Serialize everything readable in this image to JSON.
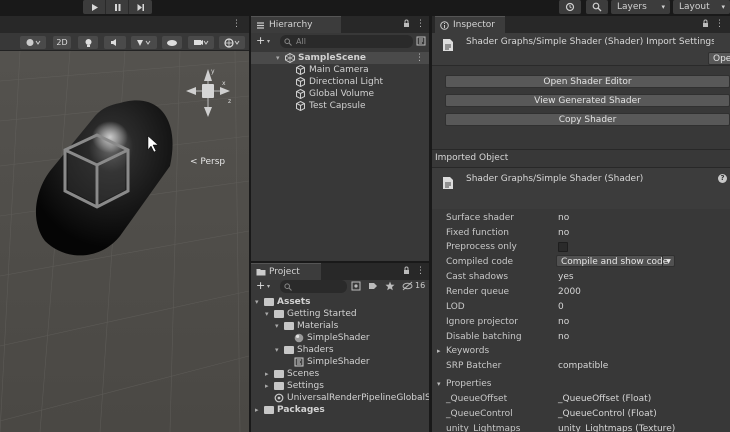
{
  "toolbar": {
    "layers_label": "Layers",
    "layout_label": "Layout",
    "caret": "▾"
  },
  "scene": {
    "mode_2d": "2D",
    "persp_label": "< Persp"
  },
  "hierarchy": {
    "tab_label": "Hierarchy",
    "add_label": "+",
    "search_placeholder": "All",
    "items": [
      {
        "label": "SampleScene"
      },
      {
        "label": "Main Camera"
      },
      {
        "label": "Directional Light"
      },
      {
        "label": "Global Volume"
      },
      {
        "label": "Test Capsule"
      }
    ]
  },
  "project": {
    "tab_label": "Project",
    "add_label": "+",
    "hidden_count": "16",
    "tree": [
      {
        "label": "Assets"
      },
      {
        "label": "Getting Started"
      },
      {
        "label": "Materials"
      },
      {
        "label": "SimpleShader"
      },
      {
        "label": "Shaders"
      },
      {
        "label": "SimpleShader"
      },
      {
        "label": "Scenes"
      },
      {
        "label": "Settings"
      },
      {
        "label": "UniversalRenderPipelineGlobalSet"
      },
      {
        "label": "Packages"
      }
    ]
  },
  "inspector": {
    "tab_label": "Inspector",
    "header_title": "Shader Graphs/Simple Shader (Shader) Import Settings",
    "open_label": "Open",
    "buttons": {
      "open_shader_editor": "Open Shader Editor",
      "view_generated": "View Generated Shader",
      "copy_shader": "Copy Shader"
    },
    "imported_object_label": "Imported Object",
    "object_title": "Shader Graphs/Simple Shader (Shader)",
    "help_icon_text": "?",
    "properties": [
      {
        "key": "Surface shader",
        "value": "no"
      },
      {
        "key": "Fixed function",
        "value": "no"
      },
      {
        "key": "Preprocess only",
        "value": ""
      },
      {
        "key": "Compiled code",
        "value": "Compile and show code"
      },
      {
        "key": "Cast shadows",
        "value": "yes"
      },
      {
        "key": "Render queue",
        "value": "2000"
      },
      {
        "key": "LOD",
        "value": "0"
      },
      {
        "key": "Ignore projector",
        "value": "no"
      },
      {
        "key": "Disable batching",
        "value": "no"
      }
    ],
    "keywords_label": "Keywords",
    "srp_batcher_label": "SRP Batcher",
    "srp_batcher_value": "compatible",
    "properties_label": "Properties",
    "shader_props": [
      {
        "key": "_QueueOffset",
        "value": "_QueueOffset (Float)"
      },
      {
        "key": "_QueueControl",
        "value": "_QueueControl (Float)"
      },
      {
        "key": "unity_Lightmaps",
        "value": "unity_Lightmaps (Texture)"
      }
    ]
  },
  "colors": {
    "scene_bg": "#5a5955",
    "panel_bg": "#383838",
    "tab_bar_bg": "#282828",
    "selected_row": "#4a4a4a",
    "button_bg": "#585858"
  }
}
